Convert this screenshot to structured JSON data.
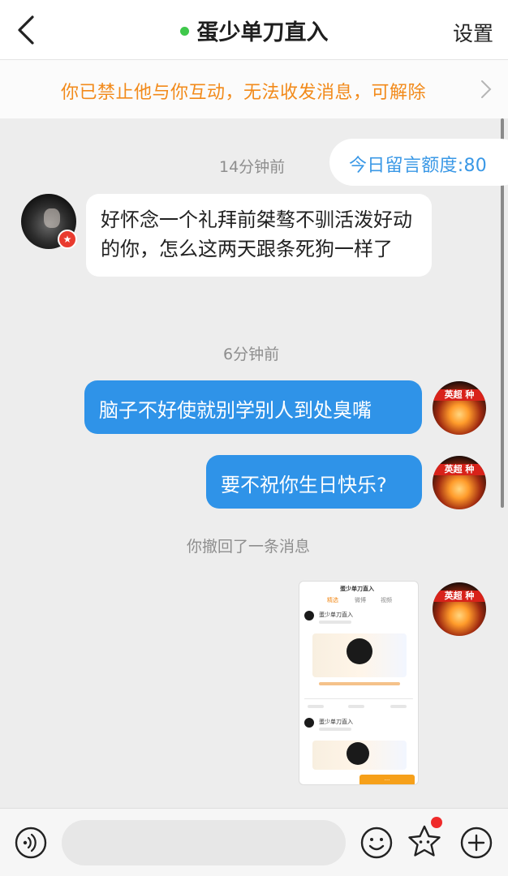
{
  "header": {
    "title": "蛋少单刀直入",
    "online_color": "#3fc84b",
    "settings_label": "设置"
  },
  "banner": {
    "text": "你已禁止他与你互动，无法收发消息，可解除",
    "text_color": "#f28a1a"
  },
  "chat": {
    "quota_label": "今日留言额度:80",
    "messages": [
      {
        "type": "timestamp",
        "text": "14分钟前"
      },
      {
        "type": "incoming",
        "text": "好怀念一个礼拜前桀骜不驯活泼好动的你，怎么这两天跟条死狗一样了"
      },
      {
        "type": "timestamp",
        "text": "6分钟前"
      },
      {
        "type": "outgoing",
        "text": "脑子不好使就别学别人到处臭嘴"
      },
      {
        "type": "outgoing",
        "text": "要不祝你生日快乐?"
      },
      {
        "type": "system",
        "text": "你撤回了一条消息"
      },
      {
        "type": "outgoing-image",
        "screenshot_title": "蛋少单刀直入",
        "screenshot_tabs": [
          "精选",
          "微博",
          "视频"
        ],
        "screenshot_user": "蛋少单刀直入"
      }
    ],
    "outgoing_avatar_band": "英超 种",
    "bubble_color": "#2f93e8"
  },
  "composer": {
    "voice_icon": "voice-icon",
    "emoji_icon": "emoji-icon",
    "sticker_icon": "star-sticker-icon",
    "plus_icon": "plus-icon"
  }
}
